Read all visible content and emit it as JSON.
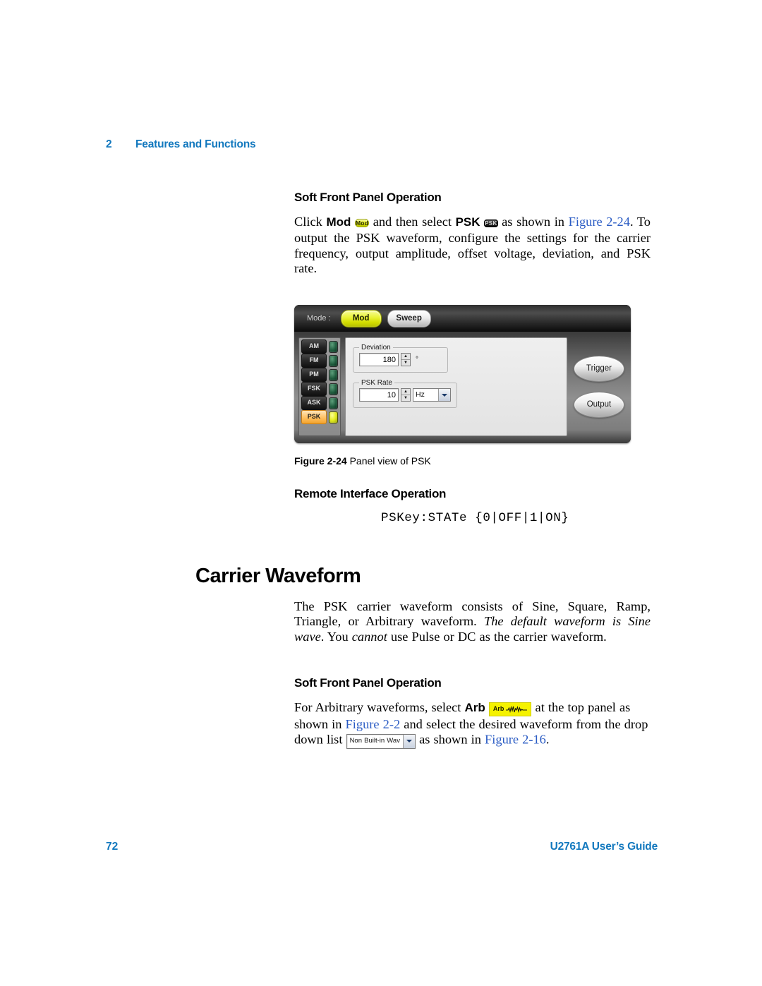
{
  "header": {
    "chapter_number": "2",
    "chapter_title": "Features and Functions"
  },
  "sections": {
    "psk_soft_panel": {
      "heading": "Soft Front Panel Operation",
      "para_click": "Click",
      "para_mod_label": "Mod",
      "para_and_then": "and then select",
      "para_psk_label": "PSK",
      "para_as_shown_in": "as shown in",
      "xref_figure": "Figure 2-24",
      "para_rest": ". To output the PSK waveform, configure the settings for the carrier frequency, output amplitude, offset voltage, deviation, and PSK rate."
    },
    "remote_interface": {
      "heading": "Remote Interface Operation",
      "command": "PSKey:STATe {0|OFF|1|ON}"
    },
    "carrier_waveform": {
      "title": "Carrier Waveform",
      "para_part1": "The PSK carrier waveform consists of Sine, Square, Ramp, Triangle, or Arbitrary waveform. ",
      "para_italic1": "The default waveform is Sine wave",
      "para_part2": ". You ",
      "para_italic2": "cannot",
      "para_part3": " use Pulse or DC as the carrier waveform."
    },
    "arb_soft_panel": {
      "heading": "Soft Front Panel Operation",
      "para_prefix": "For Arbitrary waveforms, select",
      "arb_label": "Arb",
      "para_mid1": "at the top panel as shown in",
      "xref_figure_2_2": "Figure 2-2",
      "para_mid2": "and select the desired waveform from the drop down list",
      "dropdown_value": "Non Built-in Wav",
      "para_mid3": "as shown in",
      "xref_figure_2_16": "Figure 2-16",
      "para_suffix": "."
    }
  },
  "figure": {
    "caption_number": "Figure 2-24",
    "caption_text": "Panel view of PSK",
    "panel": {
      "mode_label": "Mode :",
      "mode_buttons": [
        {
          "label": "Mod",
          "active": true
        },
        {
          "label": "Sweep",
          "active": false
        }
      ],
      "modulation_list": [
        {
          "label": "AM",
          "selected": false,
          "led_on": false
        },
        {
          "label": "FM",
          "selected": false,
          "led_on": false
        },
        {
          "label": "PM",
          "selected": false,
          "led_on": false
        },
        {
          "label": "FSK",
          "selected": false,
          "led_on": false
        },
        {
          "label": "ASK",
          "selected": false,
          "led_on": false
        },
        {
          "label": "PSK",
          "selected": true,
          "led_on": true
        }
      ],
      "deviation": {
        "group_label": "Deviation",
        "value": "180",
        "unit": "°"
      },
      "psk_rate": {
        "group_label": "PSK Rate",
        "value": "10",
        "unit": "Hz"
      },
      "action_buttons": [
        {
          "label": "Trigger"
        },
        {
          "label": "Output"
        }
      ]
    }
  },
  "footer": {
    "page_number": "72",
    "guide_title": "U2761A User’s Guide"
  },
  "colors": {
    "accent_blue": "#1278be",
    "xref_blue": "#2b5cc4",
    "active_yellow": "#eaf43c",
    "selected_orange": "#ffc061"
  }
}
